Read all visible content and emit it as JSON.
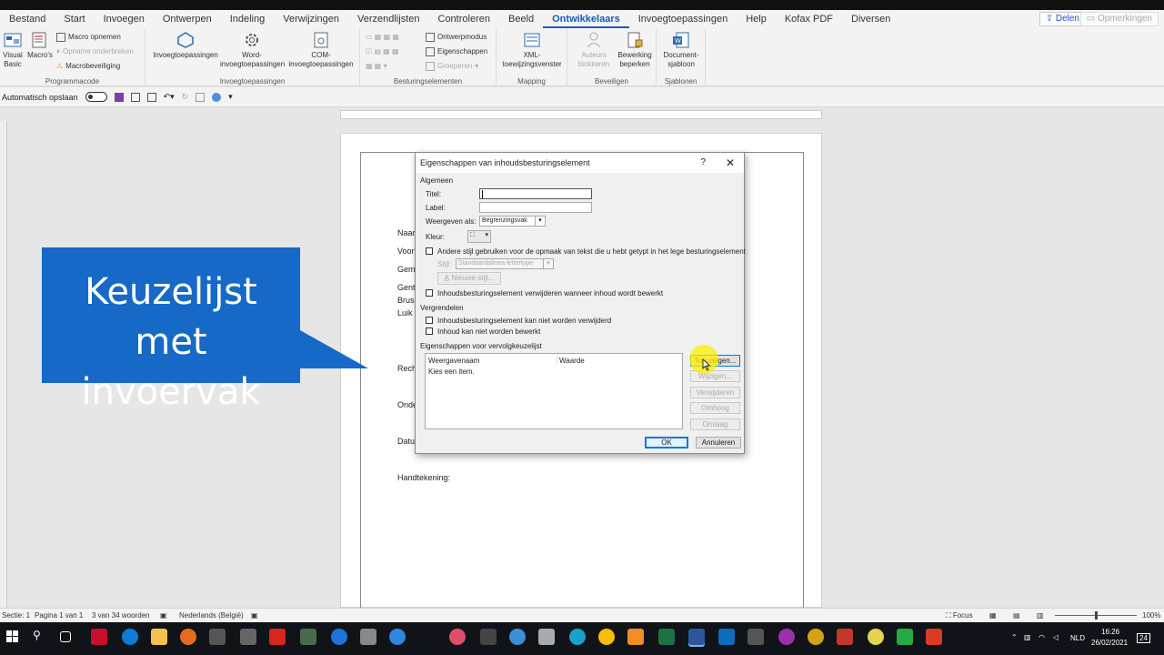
{
  "ribbon_tabs": [
    "Bestand",
    "Start",
    "Invoegen",
    "Ontwerpen",
    "Indeling",
    "Verwijzingen",
    "Verzendlijsten",
    "Controleren",
    "Beeld",
    "Ontwikkelaars",
    "Invoegtoepassingen",
    "Help",
    "Kofax PDF",
    "Diversen"
  ],
  "active_tab": "Ontwikkelaars",
  "share_label": "Delen",
  "comments_label": "Opmerkingen",
  "ribbon": {
    "visual_basic": "Visual Basic",
    "macros": "Macro's",
    "macro_record": "Macro opnemen",
    "macro_pause": "Opname onderbreken",
    "macro_security": "Macrobeveiliging",
    "group_code": "Programmacode",
    "addins": "Invoegtoepassingen",
    "word_addins": "Word-invoegtoepassingen",
    "com_addins": "COM-invoegtoepassingen",
    "group_addins": "Invoegtoepassingen",
    "design_mode": "Ontwerpmodus",
    "properties": "Eigenschappen",
    "group_btn": "Groeperen",
    "group_controls": "Besturingselementen",
    "xml_mapping": "XML-toewijzingsvenster",
    "group_mapping": "Mapping",
    "block_authors": "Auteurs blokkeren",
    "restrict_edit": "Bewerking beperken",
    "group_protect": "Beveiligen",
    "doc_template": "Document-sjabloon",
    "group_templates": "Sjablonen"
  },
  "qat": {
    "autosave": "Automatisch opslaan"
  },
  "document": {
    "lines": [
      "Naam",
      "Voor",
      "Gem",
      "Gent",
      "Bruss",
      "Luik",
      "Rech",
      "Onde",
      "Datu",
      "Handtekening:"
    ]
  },
  "callout": {
    "line1": "Keuzelijst",
    "line2": "met invoervak"
  },
  "dialog": {
    "title": "Eigenschappen van inhoudsbesturingselement",
    "help": "?",
    "close": "✕",
    "section_general": "Algemeen",
    "title_label": "Titel:",
    "title_value": "",
    "tag_label": "Label:",
    "tag_value": "",
    "display_label": "Weergeven als:",
    "display_value": "Begrenzingsvak",
    "color_label": "Kleur:",
    "style_checkbox": "Andere stijl gebruiken voor de opmaak van tekst die u hebt getypt in het lege besturingselement",
    "style_label": "Stijl:",
    "style_value": "Standaardalinea-lettertype",
    "new_style": "Nieuwe stijl...",
    "remove_checkbox": "Inhoudsbesturingselement verwijderen wanneer inhoud wordt bewerkt",
    "section_lock": "Vergrendelen",
    "lock_delete": "Inhoudsbesturingselement kan niet worden verwijderd",
    "lock_edit": "Inhoud kan niet worden bewerkt",
    "section_list": "Eigenschappen voor vervolgkeuzelijst",
    "col_display": "Weergavenaam",
    "col_value": "Waarde",
    "list_items": [
      "Kies een item."
    ],
    "btn_add": "Toevoegen...",
    "btn_modify": "Wijzigen...",
    "btn_remove": "Verwijderen",
    "btn_up": "Omhoog",
    "btn_down": "Omlaag",
    "btn_ok": "OK",
    "btn_cancel": "Annuleren"
  },
  "status": {
    "section": "Sectie: 1",
    "page": "Pagina 1 van 1",
    "words": "3 van 34 woorden",
    "language": "Nederlands (België)",
    "focus": "Focus",
    "zoom": "100%"
  },
  "taskbar": {
    "lang": "NLD",
    "time": "16:26",
    "date": "26/02/2021",
    "badge": "24"
  }
}
